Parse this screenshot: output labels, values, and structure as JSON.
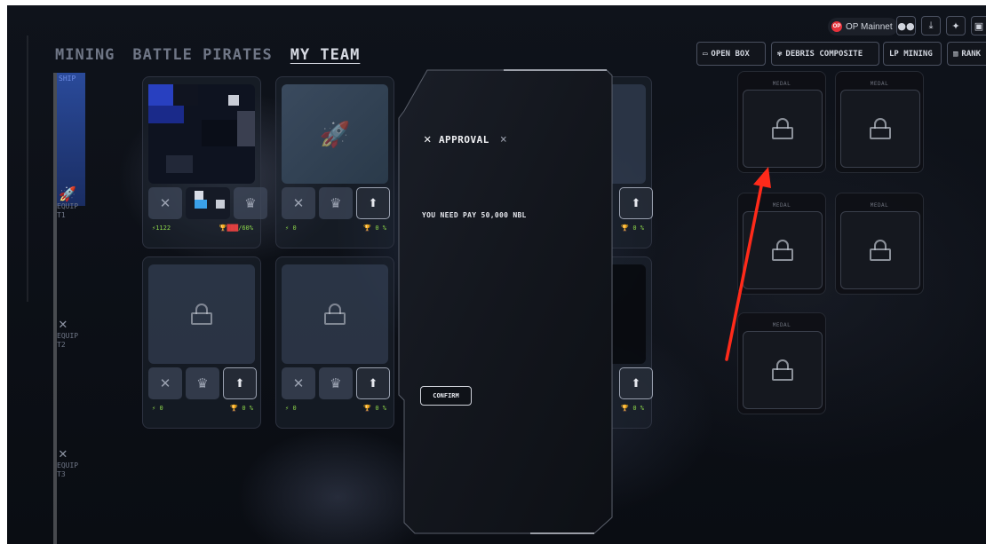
{
  "nav": {
    "tabs": [
      "MINING",
      "BATTLE PIRATES",
      "MY TEAM"
    ],
    "active": "MY TEAM"
  },
  "header": {
    "network": "OP Mainnet",
    "network_badge": "OP",
    "toolbar": [
      "OPEN BOX",
      "DEBRIS COMPOSITE",
      "LP MINING",
      "RANK"
    ]
  },
  "sidebar": {
    "ship_label": "SHIP",
    "equip_labels": [
      "EQUIP T1",
      "EQUIP T2",
      "EQUIP T3"
    ]
  },
  "cards": [
    {
      "power": "1122",
      "rate": "60%",
      "locked": false
    },
    {
      "power": "0",
      "rate": "0 %",
      "locked": false
    },
    {
      "power": "0",
      "rate": "0 %",
      "locked": true
    },
    {
      "power": "0",
      "rate": "0 %",
      "locked": true
    },
    {
      "power": "0",
      "rate": "0 %",
      "locked": true
    },
    {
      "power": "0",
      "rate": "0 %",
      "locked": true
    }
  ],
  "modal": {
    "title": "APPROVAL",
    "message": "YOU NEED PAY 50,000 NBL",
    "confirm_label": "CONFIRM"
  },
  "medals": {
    "label": "MEDAL",
    "count": 5
  },
  "colors": {
    "accent_green": "#8bd44a",
    "ship_blue": "#2a4a9a",
    "annotation_red": "#ff2a1a"
  }
}
